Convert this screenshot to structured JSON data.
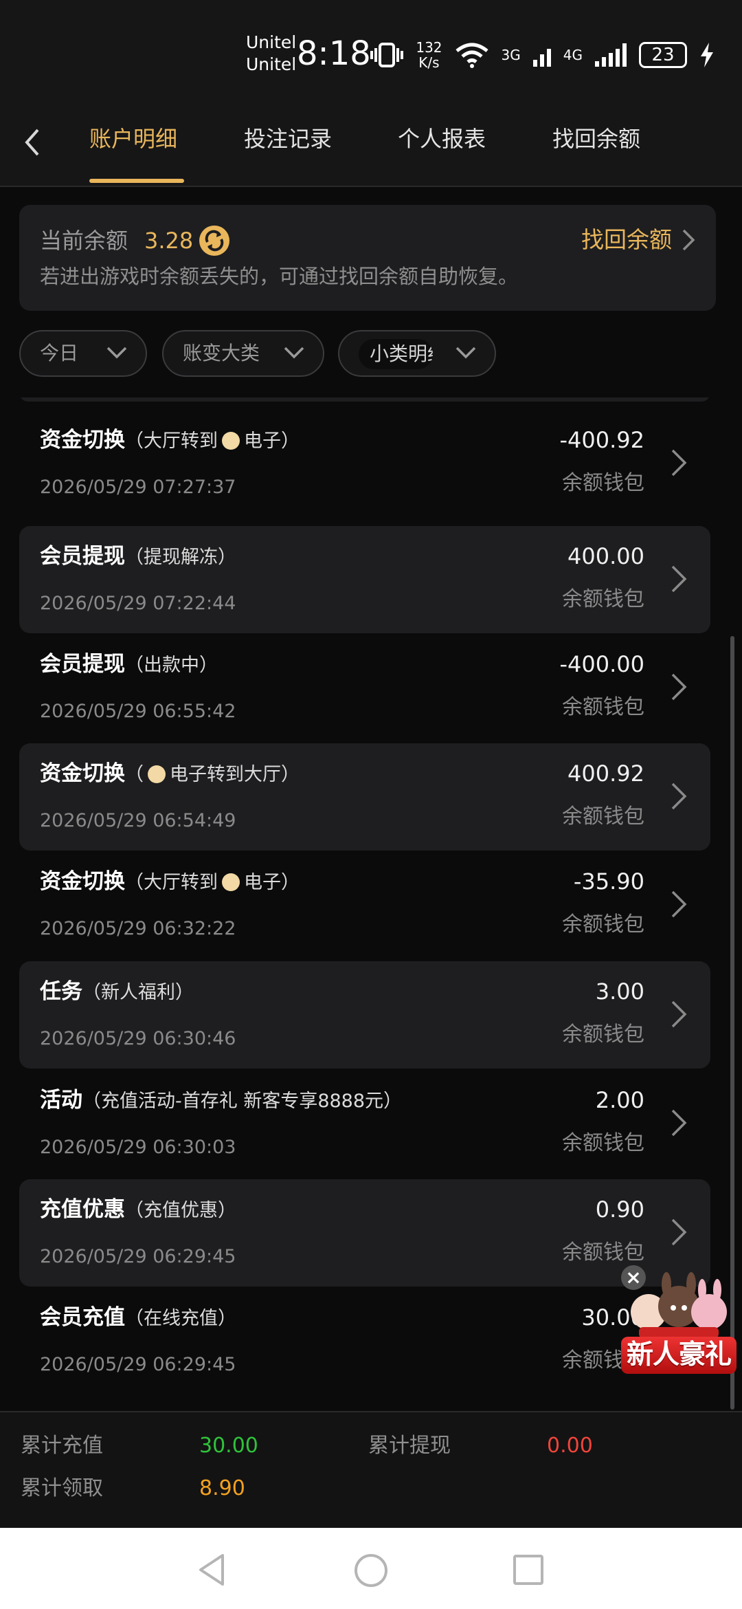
{
  "status_bar": {
    "carrier_1": "Unitel",
    "carrier_2": "Unitel",
    "time": "8:18",
    "speed_value": "132",
    "speed_unit": "K/s",
    "net_1": "3G",
    "net_2": "4G",
    "battery": "23"
  },
  "tabs": [
    {
      "label": "账户明细",
      "active": true
    },
    {
      "label": "投注记录",
      "active": false
    },
    {
      "label": "个人报表",
      "active": false
    },
    {
      "label": "找回余额",
      "active": false
    }
  ],
  "balance": {
    "label": "当前余额",
    "value": "3.28",
    "note": "若进出游戏时余额丢失的，可通过找回余额自助恢复。",
    "recover_label": "找回余额"
  },
  "filters": {
    "date": "今日",
    "category": "账变大类",
    "subcategory": "小类明细"
  },
  "records": [
    {
      "title": "资金切换",
      "detail_pre": "（大厅转到",
      "detail_post": "电子）",
      "has_icon": true,
      "time": "2026/05/29 07:27:37",
      "amount": "-400.92",
      "wallet": "余额钱包"
    },
    {
      "title": "会员提现",
      "detail_pre": "（提现解冻）",
      "detail_post": "",
      "has_icon": false,
      "time": "2026/05/29 07:22:44",
      "amount": "400.00",
      "wallet": "余额钱包"
    },
    {
      "title": "会员提现",
      "detail_pre": "（出款中）",
      "detail_post": "",
      "has_icon": false,
      "time": "2026/05/29 06:55:42",
      "amount": "-400.00",
      "wallet": "余额钱包"
    },
    {
      "title": "资金切换",
      "detail_pre": "（",
      "detail_post": "电子转到大厅）",
      "has_icon": true,
      "time": "2026/05/29 06:54:49",
      "amount": "400.92",
      "wallet": "余额钱包"
    },
    {
      "title": "资金切换",
      "detail_pre": "（大厅转到",
      "detail_post": "电子）",
      "has_icon": true,
      "time": "2026/05/29 06:32:22",
      "amount": "-35.90",
      "wallet": "余额钱包"
    },
    {
      "title": "任务",
      "detail_pre": "（新人福利）",
      "detail_post": "",
      "has_icon": false,
      "time": "2026/05/29 06:30:46",
      "amount": "3.00",
      "wallet": "余额钱包"
    },
    {
      "title": "活动",
      "detail_pre": "（充值活动-首存礼 新客专享8888元）",
      "detail_post": "",
      "has_icon": false,
      "time": "2026/05/29 06:30:03",
      "amount": "2.00",
      "wallet": "余额钱包"
    },
    {
      "title": "充值优惠",
      "detail_pre": "（充值优惠）",
      "detail_post": "",
      "has_icon": false,
      "time": "2026/05/29 06:29:45",
      "amount": "0.90",
      "wallet": "余额钱包"
    },
    {
      "title": "会员充值",
      "detail_pre": "（在线充值）",
      "detail_post": "",
      "has_icon": false,
      "time": "2026/05/29 06:29:45",
      "amount": "30.00",
      "wallet": "余额钱包"
    }
  ],
  "promo": {
    "label": "新人豪礼",
    "close": "×"
  },
  "summary": {
    "deposit_label": "累计充值",
    "deposit_value": "30.00",
    "withdraw_label": "累计提现",
    "withdraw_value": "0.00",
    "claim_label": "累计领取",
    "claim_value": "8.90"
  },
  "colors": {
    "accent_gold": "#e9b65b",
    "positive_green": "#2fc33a",
    "negative_red": "#f0443a",
    "claim_orange": "#f3a11f"
  }
}
